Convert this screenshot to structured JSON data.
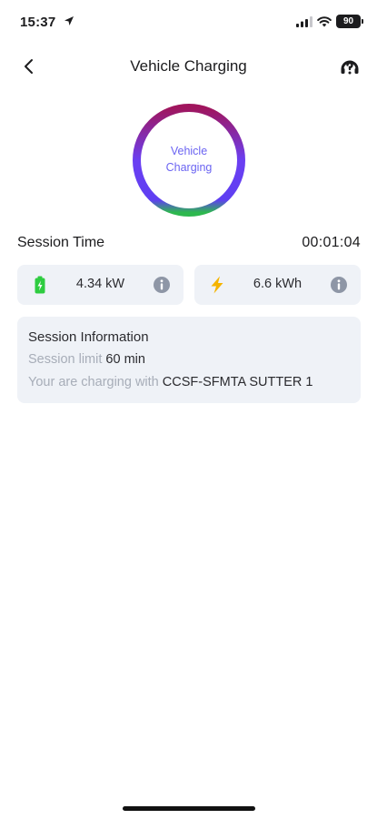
{
  "status_bar": {
    "time": "15:37",
    "battery": "90"
  },
  "header": {
    "title": "Vehicle Charging"
  },
  "ring": {
    "line1": "Vehicle",
    "line2": "Charging",
    "colors": [
      "#a0155d",
      "#6b3ff2",
      "#2db84e"
    ]
  },
  "session": {
    "label": "Session Time",
    "value": "00:01:04"
  },
  "stats": {
    "power": {
      "value": "4.34 kW",
      "icon": "battery-charging-icon",
      "color": "#2ecc40"
    },
    "energy": {
      "value": "6.6 kWh",
      "icon": "lightning-icon",
      "color": "#f5b400"
    }
  },
  "session_info": {
    "title": "Session Information",
    "limit_label": "Session limit",
    "limit_value": "60 min",
    "charger_label": "Your are charging with",
    "charger_value": "CCSF-SFMTA SUTTER 1"
  }
}
